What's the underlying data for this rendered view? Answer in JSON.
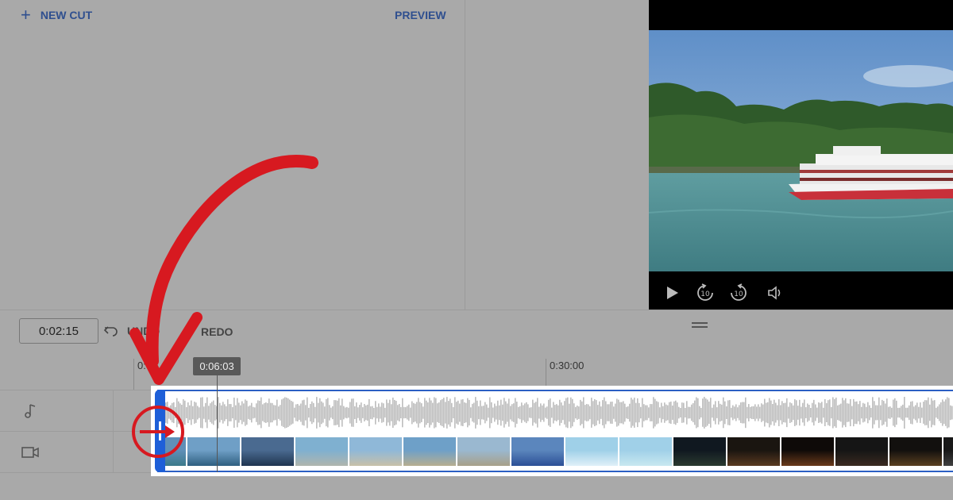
{
  "toolbar": {
    "new_cut_label": "NEW CUT",
    "preview_label": "PREVIEW"
  },
  "timeline_controls": {
    "current_time": "0:02:15",
    "undo_label": "UNDO",
    "redo_label": "REDO"
  },
  "ruler": {
    "start_label": "0:0",
    "mid_label": "0:30:00",
    "playhead_time": "0:06:03"
  },
  "player": {
    "replay_seconds": "10",
    "forward_seconds": "10"
  },
  "icons": {
    "new_cut": "plus-icon",
    "undo": "undo-arrow-icon",
    "audio_track": "music-note-icon",
    "video_track": "video-camera-icon",
    "play": "play-icon",
    "replay": "replay-10-icon",
    "forward": "forward-10-icon",
    "volume": "volume-icon"
  },
  "colors": {
    "accent_blue": "#2f4f8f",
    "trim_handle_blue": "#1e5fd8",
    "annotation_red": "#d71920"
  }
}
